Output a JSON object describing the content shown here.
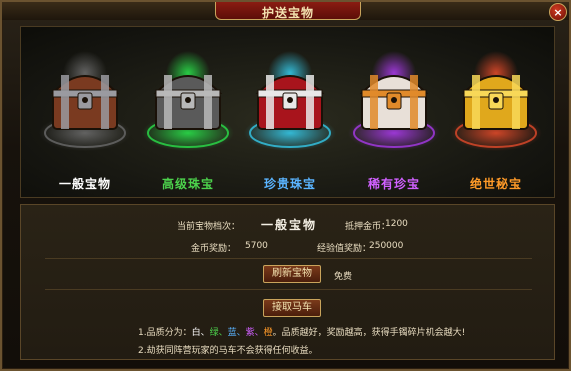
{
  "window": {
    "title": "护送宝物",
    "close_icon": "×"
  },
  "chests": [
    {
      "name": "一般宝物",
      "name_color": "#ffffff",
      "glow": "#6a6a6a",
      "body": "#7a3a20",
      "trim": "#9a9aa0"
    },
    {
      "name": "高级珠宝",
      "name_color": "#4cd24c",
      "glow": "#2adf4a",
      "body": "#5a5a5a",
      "trim": "#b8b8b8"
    },
    {
      "name": "珍贵珠宝",
      "name_color": "#5ab4ff",
      "glow": "#35c8e8",
      "body": "#a8141c",
      "trim": "#e8e8e8"
    },
    {
      "name": "稀有珍宝",
      "name_color": "#d060ff",
      "glow": "#a83ae8",
      "body": "#e8e0d8",
      "trim": "#e08a2a"
    },
    {
      "name": "绝世秘宝",
      "name_color": "#ff9a28",
      "glow": "#e04a2a",
      "body": "#e0a81c",
      "trim": "#f8d858"
    }
  ],
  "info": {
    "current_grade_label": "当前宝物档次：",
    "current_grade_value": "一般宝物",
    "deposit_label": "抵押金币：",
    "deposit_value": "1200",
    "gold_reward_label": "金币奖励：",
    "gold_reward_value": "5700",
    "exp_reward_label": "经验值奖励：",
    "exp_reward_value": "250000"
  },
  "actions": {
    "refresh_label": "刷新宝物",
    "free_label": "免费",
    "escort_label": "接取马车"
  },
  "notes": {
    "line1_prefix": "1.品质分为：",
    "q_white": "白、",
    "q_green": "绿、",
    "q_blue": "蓝、",
    "q_purple": "紫、",
    "q_orange": "橙",
    "line1_suffix": "。品质越好，奖励越高，获得手镯碎片机会越大!",
    "line2": "2.劫获同阵营玩家的马车不会获得任何收益。",
    "colors": {
      "white": "#ffffff",
      "green": "#4cd24c",
      "blue": "#5ab4ff",
      "purple": "#d060ff",
      "orange": "#ff9a28"
    }
  }
}
